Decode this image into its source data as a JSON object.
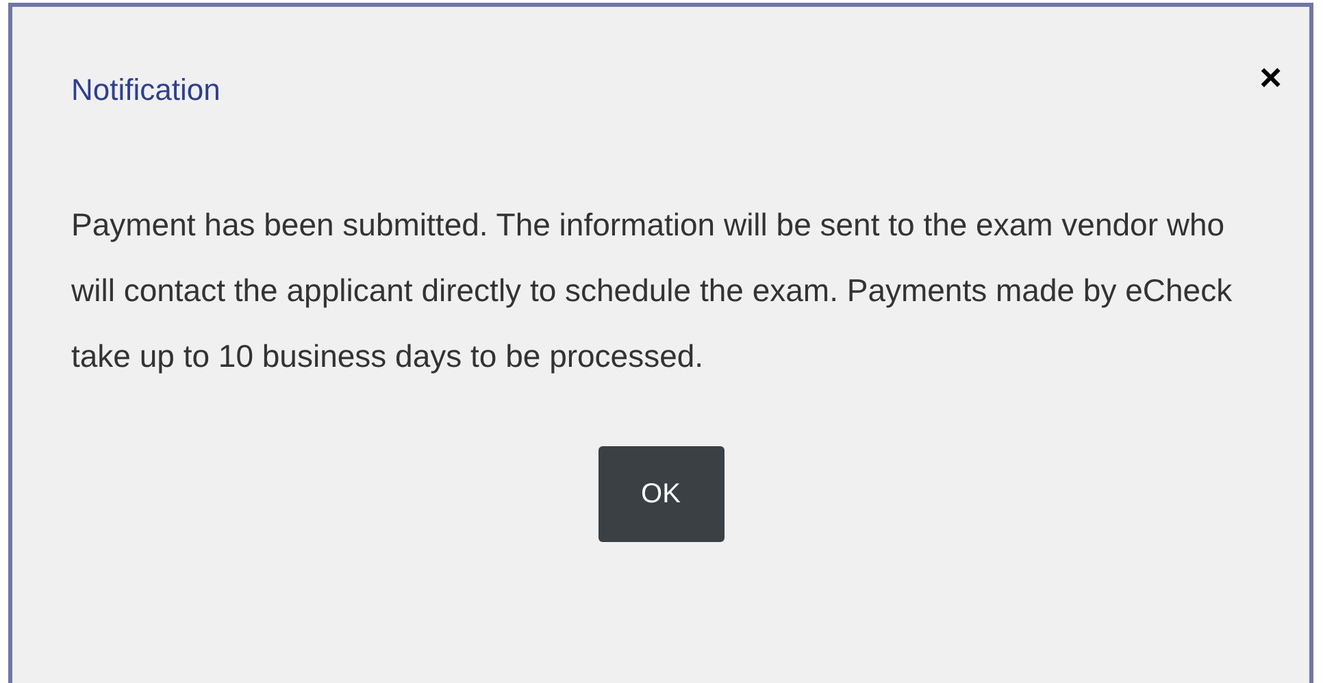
{
  "dialog": {
    "title": "Notification",
    "close": "×",
    "message": "Payment has been submitted. The information will be sent to the exam vendor who will contact the applicant directly to schedule the exam. Payments made by eCheck take up to 10 business days to be processed.",
    "buttons": [
      "OK"
    ]
  }
}
